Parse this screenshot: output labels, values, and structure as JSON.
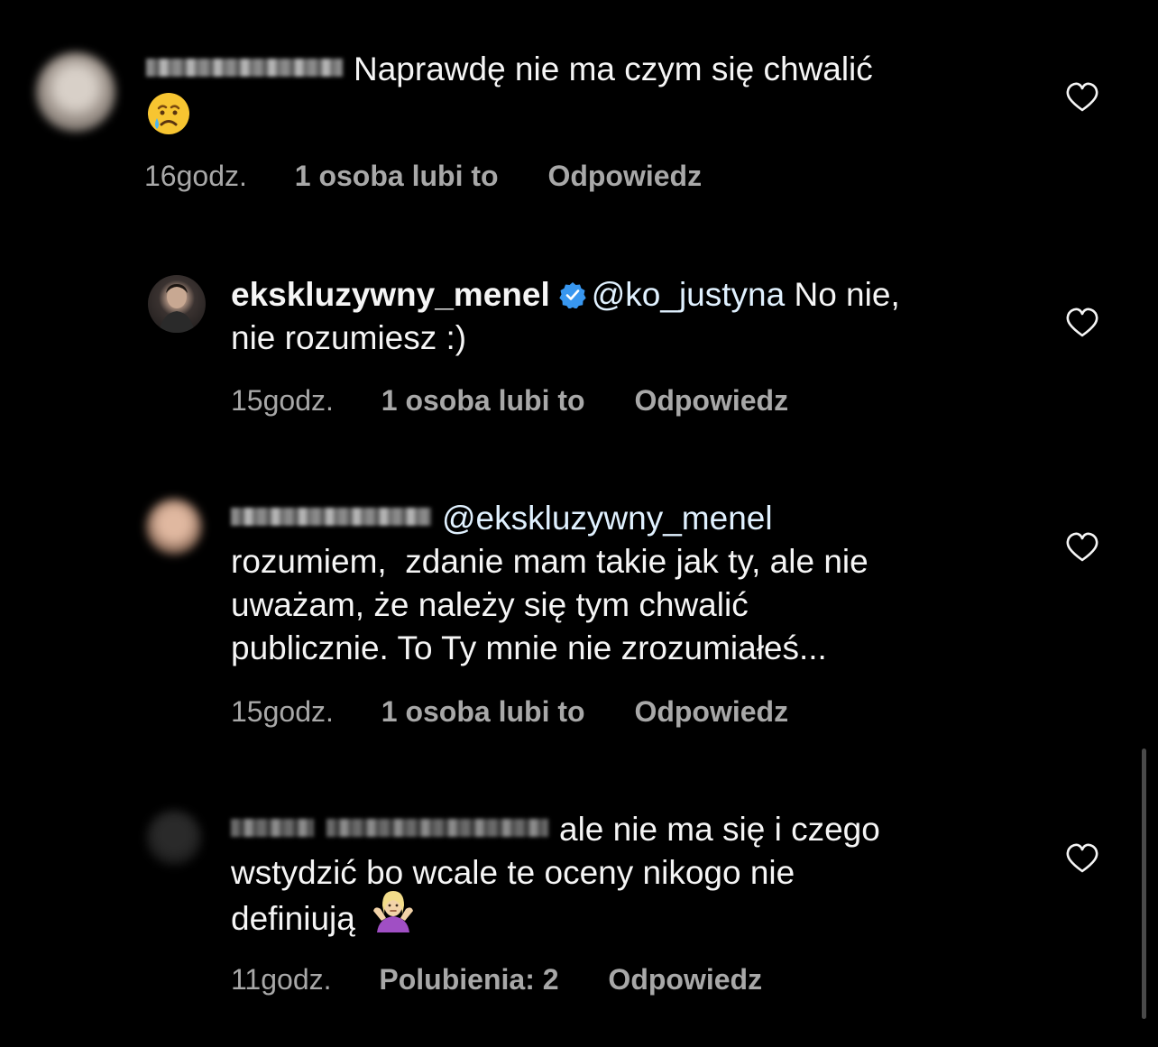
{
  "comments": [
    {
      "text": "Naprawdę nie ma czym się chwalić",
      "emoji_name": "crying-face-emoji",
      "time": "16godz.",
      "likes": "1 osoba lubi to",
      "reply": "Odpowiedz"
    },
    {
      "author": "ekskluzywny_menel",
      "verified": true,
      "mention": "@ko_justyna",
      "text_line1": "No nie,",
      "text_line2": "nie rozumiesz :)",
      "time": "15godz.",
      "likes": "1 osoba lubi to",
      "reply": "Odpowiedz"
    },
    {
      "mention": "@ekskluzywny_menel",
      "text_line1": "rozumiem,  zdanie mam takie jak ty, ale nie",
      "text_line2": "uważam, że należy się tym chwalić",
      "text_line3": "publicznie. To Ty mnie nie zrozumiałeś...",
      "time": "15godz.",
      "likes": "1 osoba lubi to",
      "reply": "Odpowiedz"
    },
    {
      "text_line1": "ale nie ma się i czego",
      "text_line2": "wstydzić bo wcale te oceny nikogo nie",
      "text_line3": "definiują",
      "emoji_name": "person-shrugging-emoji",
      "time": "11godz.",
      "likes": "Polubienia: 2",
      "reply": "Odpowiedz"
    }
  ],
  "colors": {
    "background": "#000000",
    "text": "#f5f5f5",
    "meta": "#a8a8a8",
    "verified_badge": "#3897f0"
  }
}
